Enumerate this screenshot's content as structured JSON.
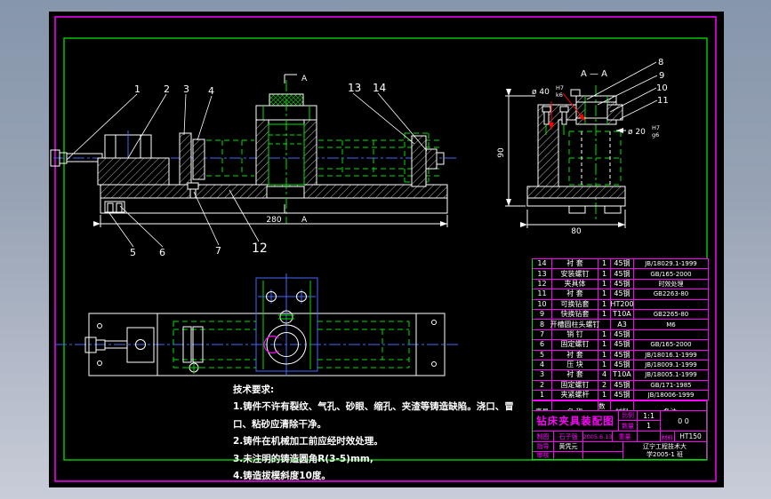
{
  "colors": {
    "line": "#ffffff",
    "hidden": "#00e000",
    "center": "#4466ff",
    "grid": "#ff00ff",
    "annot": "#ff0000",
    "paper": "#000000"
  },
  "views": {
    "main": {
      "callouts": [
        "1",
        "2",
        "3",
        "4",
        "5",
        "6",
        "7",
        "12",
        "13",
        "14"
      ],
      "dim_width": "280",
      "section_letter": "A"
    },
    "section": {
      "title": "A — A",
      "callouts": [
        "8",
        "9",
        "10",
        "11"
      ],
      "dim_height": "90",
      "dim_width": "80",
      "dia40_prefix": "ø 40",
      "dia40_num": "H7",
      "dia40_den": "k6",
      "dia20_prefix": "ø 20",
      "dia20_num": "H7",
      "dia20_den": "g6"
    }
  },
  "tech": {
    "title": "技术要求:",
    "lines": [
      "1.铸件不许有裂纹、气孔、砂眼、缩孔、夹渣等铸造缺陷。浇口、冒",
      "口、粘砂应清除干净。",
      "2.铸件在机械加工前应经时效处理。",
      "3.未注明的铸造圆角R(3-5)mm,",
      "4.铸造拔模斜度10度。"
    ]
  },
  "parts": {
    "headers": [
      "序号",
      "名 称",
      "数量",
      "材料",
      "备注"
    ],
    "rows": [
      {
        "num": "14",
        "name": "衬 套",
        "qty": "1",
        "mat": "45钢",
        "note": "JB/18029.1-1999"
      },
      {
        "num": "13",
        "name": "安装螺钉",
        "qty": "1",
        "mat": "45钢",
        "note": "GB/165-2000"
      },
      {
        "num": "12",
        "name": "夹具体",
        "qty": "1",
        "mat": "45钢",
        "note": "时效处理"
      },
      {
        "num": "11",
        "name": "衬 套",
        "qty": "1",
        "mat": "45钢",
        "note": "GB2263-80"
      },
      {
        "num": "10",
        "name": "可换钻套",
        "qty": "1",
        "mat": "HT200",
        "note": ""
      },
      {
        "num": "9",
        "name": "快换钻套",
        "qty": "1",
        "mat": "T10A",
        "note": "GB2265-80"
      },
      {
        "num": "8",
        "name": "开槽圆柱头螺钉",
        "qty": "",
        "mat": "A3",
        "note": "M6"
      },
      {
        "num": "7",
        "name": "销 钉",
        "qty": "1",
        "mat": "45钢",
        "note": ""
      },
      {
        "num": "6",
        "name": "固定螺钉",
        "qty": "1",
        "mat": "45钢",
        "note": "GB/165-2000"
      },
      {
        "num": "5",
        "name": "衬 套",
        "qty": "1",
        "mat": "45钢",
        "note": "JB/18016.1-1999"
      },
      {
        "num": "4",
        "name": "压 块",
        "qty": "1",
        "mat": "45钢",
        "note": "JB/18009.1-1999"
      },
      {
        "num": "3",
        "name": "衬 套",
        "qty": "4",
        "mat": "T10A",
        "note": "JB/18005.1-1999"
      },
      {
        "num": "2",
        "name": "固定螺钉",
        "qty": "2",
        "mat": "45钢",
        "note": "GB/171-1985"
      },
      {
        "num": "1",
        "name": "夹紧螺杆",
        "qty": "1",
        "mat": "45钢",
        "note": "JB/18006-1999"
      }
    ]
  },
  "title_block": {
    "title": "钻床夹具装配图",
    "scale_label": "比例",
    "scale": "1:1",
    "qty_label": "数量",
    "qty": "1",
    "sheet": "0 0",
    "draw_label": "制图",
    "draw_name": "石子强",
    "draw_date": "2005.6.13",
    "weight_label": "重量",
    "material_label": "材料",
    "material": "HT150",
    "advisor_label": "指导",
    "advisor": "黄凭元",
    "check_label": "审核",
    "school_line1": "辽宁工程技术大",
    "school_line2": "学2005-1 班"
  }
}
